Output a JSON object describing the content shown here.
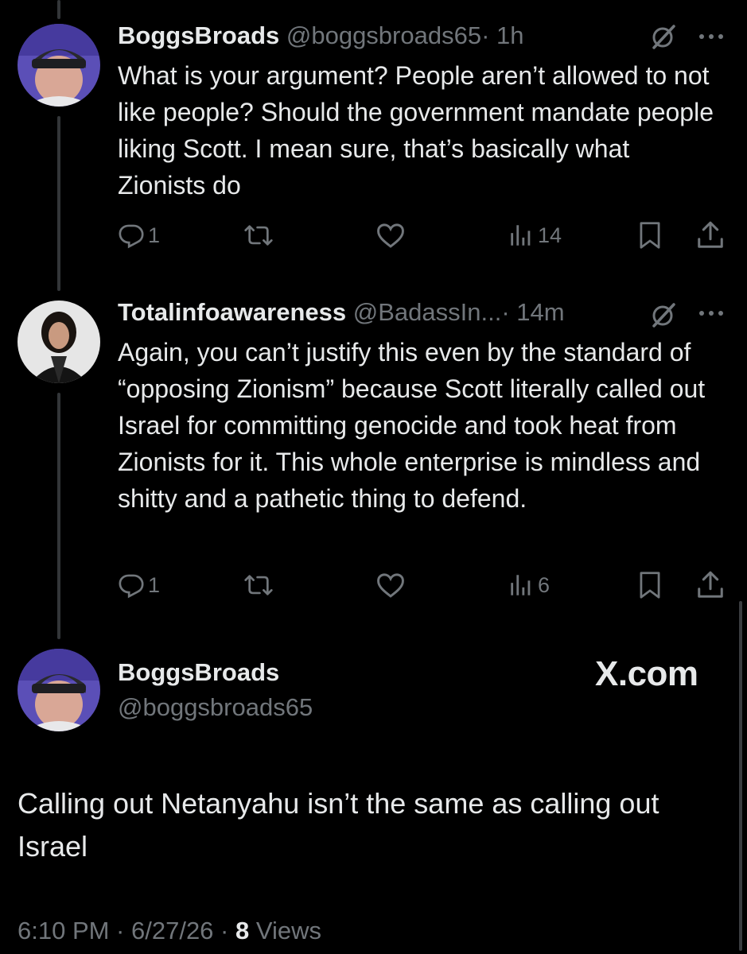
{
  "tweets": [
    {
      "name": "BoggsBroads",
      "handle": "@boggsbroads65",
      "time": "· 1h",
      "text": "What is your argument? People aren’t allowed to not like people? Should the government mandate people liking Scott. I mean sure, that’s basically what Zionists do",
      "replies": "1",
      "views": "14"
    },
    {
      "name": "Totalinfoawareness",
      "handle": "@BadassIn...",
      "time": "· 14m",
      "text": "Again, you can’t justify this even by the standard of “opposing Zionism” because Scott literally called out Israel for committing genocide and took heat from Zionists for it. This whole enterprise is mindless and shitty and a pathetic thing to defend.",
      "replies": "1",
      "views": "6"
    }
  ],
  "main_tweet": {
    "name": "BoggsBroads",
    "handle": "@boggsbroads65",
    "text": "Calling out Netanyahu isn’t the same as calling out Israel",
    "date": "6:10 PM · 6/27/26 · ",
    "view_count": "8",
    "views_label": " Views"
  },
  "watermark": "X.com",
  "icons": [
    "reply-icon",
    "retweet-icon",
    "like-icon",
    "views-icon",
    "bookmark-icon",
    "share-icon",
    "grok-icon",
    "more-icon"
  ],
  "colors": {
    "background": "#000000",
    "text": "#e7e9ea",
    "secondary": "#71767b",
    "thread_line": "#333639"
  }
}
